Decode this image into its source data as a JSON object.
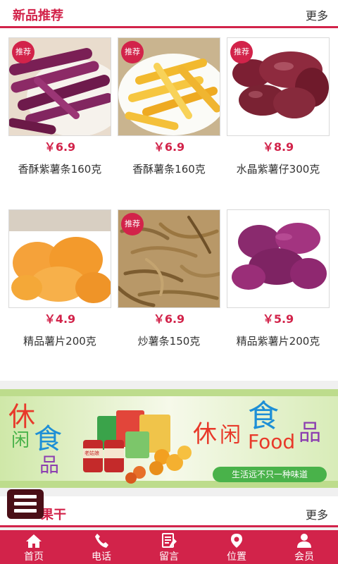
{
  "section1": {
    "title": "新品推荐",
    "more": "更多"
  },
  "products": [
    {
      "badge": "推荐",
      "price": "￥6.9",
      "name": "香酥紫薯条160克",
      "image": "purple-sweet-potato-strips"
    },
    {
      "badge": "推荐",
      "price": "￥6.9",
      "name": "香酥薯条160克",
      "image": "sweet-potato-fries"
    },
    {
      "badge": "推荐",
      "price": "￥8.9",
      "name": "水晶紫薯仔300克",
      "image": "crystal-purple-potato"
    },
    {
      "badge": "",
      "price": "￥4.9",
      "name": "精品薯片200克",
      "image": "dried-potato-slices"
    },
    {
      "badge": "推荐",
      "price": "￥6.9",
      "name": "炒薯条150克",
      "image": "fried-potato-strips"
    },
    {
      "badge": "",
      "price": "￥5.9",
      "name": "精品紫薯片200克",
      "image": "purple-potato-slices"
    }
  ],
  "banner": {
    "left_chars": [
      "休",
      "闲",
      "食",
      "品"
    ],
    "right_chars": [
      "休",
      "闲",
      "食",
      "品"
    ],
    "food_text": "Food",
    "slogan": "生活远不只一种味道",
    "can_text": "老姑娘",
    "colors": {
      "orange": "#e8392a",
      "green": "#49b24a",
      "blue": "#1e8fd6",
      "purple": "#8c3fb0"
    }
  },
  "section2": {
    "title": "果干",
    "more": "更多"
  },
  "nav": [
    {
      "label": "首页",
      "icon": "home-icon"
    },
    {
      "label": "电话",
      "icon": "phone-icon"
    },
    {
      "label": "留言",
      "icon": "message-icon"
    },
    {
      "label": "位置",
      "icon": "location-icon"
    },
    {
      "label": "会员",
      "icon": "member-icon"
    }
  ],
  "colors": {
    "accent": "#d2234a"
  }
}
